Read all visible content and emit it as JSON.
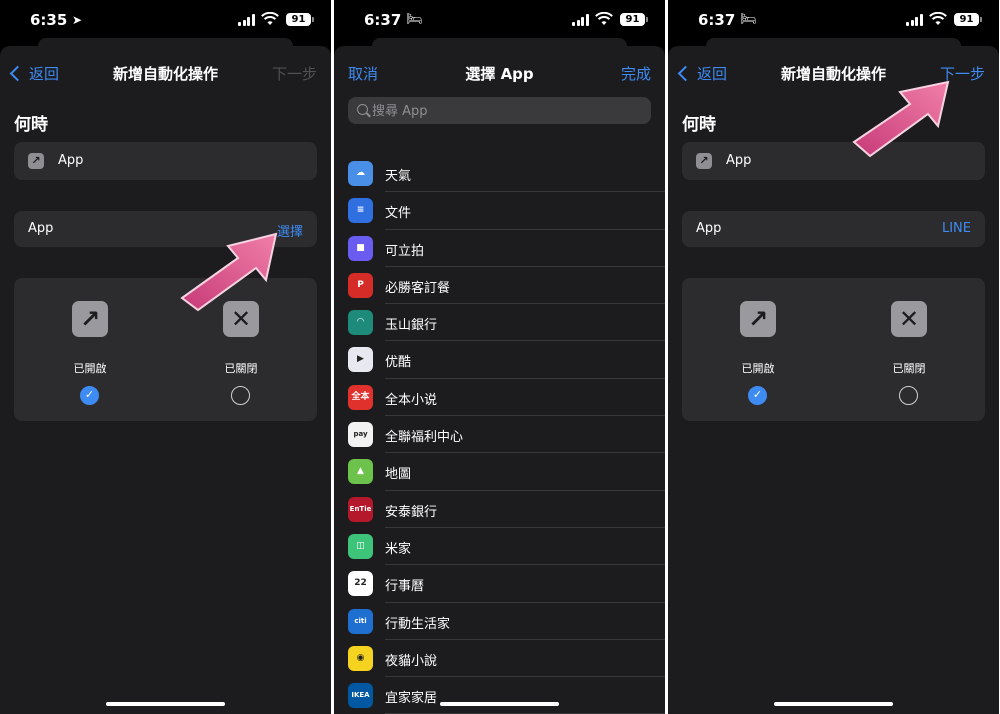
{
  "panels": [
    {
      "time": "6:35",
      "time_icon": "location-arrow-icon",
      "battery": "91",
      "nav": {
        "back_label": "返回",
        "title": "新增自動化操作",
        "next_label": "下一步"
      },
      "section_title": "何時",
      "trigger_row": {
        "icon": "app-arrow-icon",
        "label": "App"
      },
      "app_row": {
        "label": "App",
        "value": "選擇"
      },
      "toggles": [
        {
          "icon": "arrow-up-right-icon",
          "label": "已開啟",
          "selected": true
        },
        {
          "icon": "xmark-icon",
          "label": "已關閉",
          "selected": false
        }
      ]
    },
    {
      "time": "6:37",
      "time_icon": "bed-icon",
      "battery": "91",
      "nav": {
        "cancel_label": "取消",
        "title": "選擇 App",
        "done_label": "完成"
      },
      "search": {
        "placeholder": "搜尋 App"
      },
      "apps": [
        {
          "name": "天氣",
          "icon": "weather-icon",
          "color": "#4a8fe7",
          "glyph": "☁"
        },
        {
          "name": "文件",
          "icon": "docs-icon",
          "color": "#2f6fe0",
          "glyph": "≡"
        },
        {
          "name": "可立拍",
          "icon": "clips-icon",
          "color": "#6a5cf0",
          "glyph": "■"
        },
        {
          "name": "必勝客訂餐",
          "icon": "pizza-hut-icon",
          "color": "#d62c27",
          "glyph": "P"
        },
        {
          "name": "玉山銀行",
          "icon": "esun-bank-icon",
          "color": "#1d8a7a",
          "glyph": "◠"
        },
        {
          "name": "优酷",
          "icon": "youku-icon",
          "color": "#e8e8f0",
          "glyph": "▶"
        },
        {
          "name": "全本小说",
          "icon": "novel-icon",
          "color": "#e0312c",
          "glyph": "全本"
        },
        {
          "name": "全聯福利中心",
          "icon": "pxpay-icon",
          "color": "#f2f2f2",
          "glyph": "pay"
        },
        {
          "name": "地圖",
          "icon": "maps-icon",
          "color": "#6cc24a",
          "glyph": "▲"
        },
        {
          "name": "安泰銀行",
          "icon": "entie-bank-icon",
          "color": "#b5172b",
          "glyph": "EnTie"
        },
        {
          "name": "米家",
          "icon": "mijia-icon",
          "color": "#3ec47a",
          "glyph": "◫"
        },
        {
          "name": "行事曆",
          "icon": "calendar-icon",
          "color": "#ffffff",
          "glyph": "22"
        },
        {
          "name": "行動生活家",
          "icon": "citi-icon",
          "color": "#1f6fd1",
          "glyph": "citi"
        },
        {
          "name": "夜貓小說",
          "icon": "owl-icon",
          "color": "#f5d320",
          "glyph": "◉"
        },
        {
          "name": "宜家家居",
          "icon": "ikea-icon",
          "color": "#0058a3",
          "glyph": "IKEA"
        }
      ]
    },
    {
      "time": "6:37",
      "time_icon": "bed-icon",
      "battery": "91",
      "nav": {
        "back_label": "返回",
        "title": "新增自動化操作",
        "next_label": "下一步"
      },
      "section_title": "何時",
      "trigger_row": {
        "icon": "app-arrow-icon",
        "label": "App"
      },
      "app_row": {
        "label": "App",
        "value": "LINE"
      },
      "toggles": [
        {
          "icon": "arrow-up-right-icon",
          "label": "已開啟",
          "selected": true
        },
        {
          "icon": "xmark-icon",
          "label": "已關閉",
          "selected": false
        }
      ]
    }
  ],
  "colors": {
    "accent": "#3e8bf3",
    "sheet": "#1c1c1e",
    "card": "#2c2c2e",
    "annotation_arrow": "#d9407a"
  }
}
